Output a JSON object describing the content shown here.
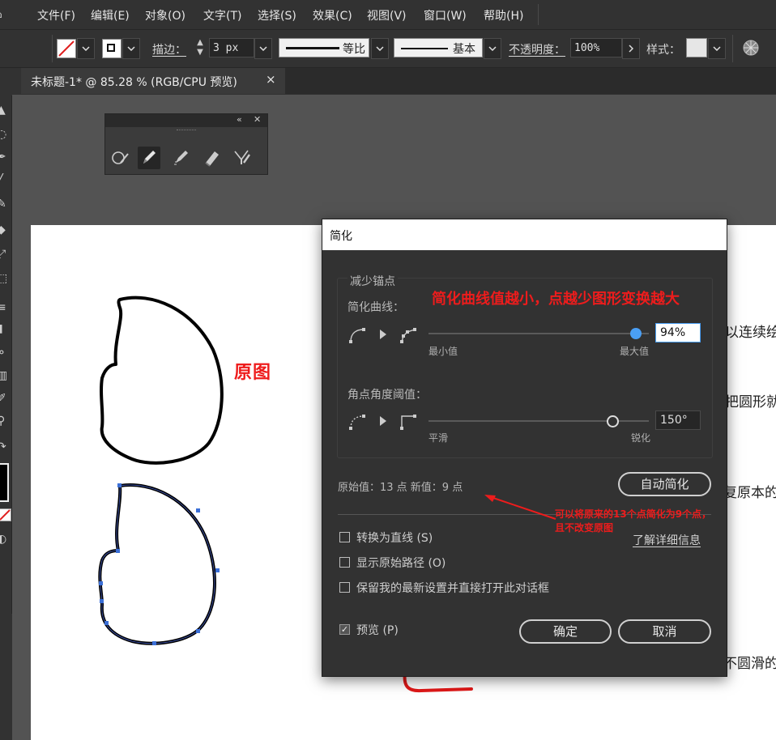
{
  "menubar": {
    "items": [
      "文件(F)",
      "编辑(E)",
      "对象(O)",
      "文字(T)",
      "选择(S)",
      "效果(C)",
      "视图(V)",
      "窗口(W)",
      "帮助(H)"
    ]
  },
  "control_bar": {
    "stroke_label": "描边：",
    "stroke_weight": "3 px",
    "profile_label": "等比",
    "brush_label": "基本",
    "opacity_label": "不透明度：",
    "opacity_value": "100%",
    "style_label": "样式："
  },
  "tab": {
    "title": "未标题-1* @ 85.28 % (RGB/CPU 预览)",
    "close": "×"
  },
  "pencil_panel": {
    "collapse": "«",
    "close": "✕"
  },
  "annotations": {
    "original_label": "原图",
    "curve_note": "简化曲线值越小，点越少图形变换越大",
    "points_note_line1": "可以将原来的13个点简化为9个点，",
    "points_note_line2": "且不改变原图"
  },
  "background_text": {
    "line1": "以连续绘",
    "line2": "把圆形就",
    "line3": "复原本的",
    "line4": "不圆滑的"
  },
  "dialog": {
    "title": "简化",
    "group_title": "减少锚点",
    "curve_label": "简化曲线：",
    "curve_min": "最小值",
    "curve_max": "最大值",
    "curve_value": "94%",
    "curve_value_fraction": 0.94,
    "angle_label": "角点角度阈值：",
    "angle_min": "平滑",
    "angle_max": "锐化",
    "angle_value": "150°",
    "angle_value_degrees": 150,
    "info": "原始值：13 点   新值：9 点",
    "auto_button": "自动简化",
    "learn_more": "了解详细信息",
    "option_lines": "转换为直线 (S)",
    "option_show_original": "显示原始路径 (O)",
    "option_keep": "保留我的最新设置并直接打开此对话框",
    "preview": "预览 (P)",
    "ok": "确定",
    "cancel": "取消"
  },
  "colors": {
    "annotation_red": "#ee1c1c",
    "slider_blue": "#4a9ff5",
    "path_outline": "#3b4fa0"
  }
}
